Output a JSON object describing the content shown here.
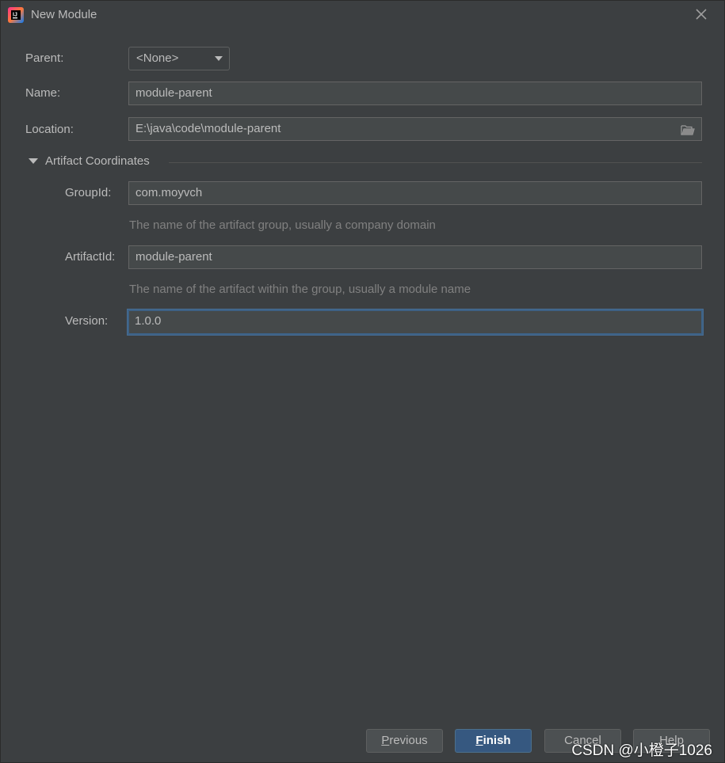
{
  "window": {
    "title": "New Module",
    "app_icon": "intellij-idea-icon",
    "close_icon": "close-icon"
  },
  "form": {
    "parent": {
      "label": "Parent:",
      "value": "<None>"
    },
    "name": {
      "label": "Name:",
      "value": "module-parent"
    },
    "location": {
      "label": "Location:",
      "value": "E:\\java\\code\\module-parent",
      "browse_icon": "folder-icon"
    }
  },
  "artifact": {
    "section_title": "Artifact Coordinates",
    "expanded": true,
    "group_id": {
      "label": "GroupId:",
      "value": "com.moyvch",
      "hint": "The name of the artifact group, usually a company domain"
    },
    "artifact_id": {
      "label": "ArtifactId:",
      "value": "module-parent",
      "hint": "The name of the artifact within the group, usually a module name"
    },
    "version": {
      "label": "Version:",
      "value": "1.0.0"
    }
  },
  "buttons": {
    "previous_mnemonic": "P",
    "previous_rest": "revious",
    "finish_mnemonic": "F",
    "finish_rest": "inish",
    "cancel": "Cancel",
    "help": "Help"
  },
  "watermark": "CSDN @小橙子1026",
  "colors": {
    "background": "#3c3f41",
    "field_bg": "#45494a",
    "primary_button": "#365880",
    "focus_border": "#3d6185",
    "text": "#bbbbbb",
    "hint_text": "#808080"
  }
}
